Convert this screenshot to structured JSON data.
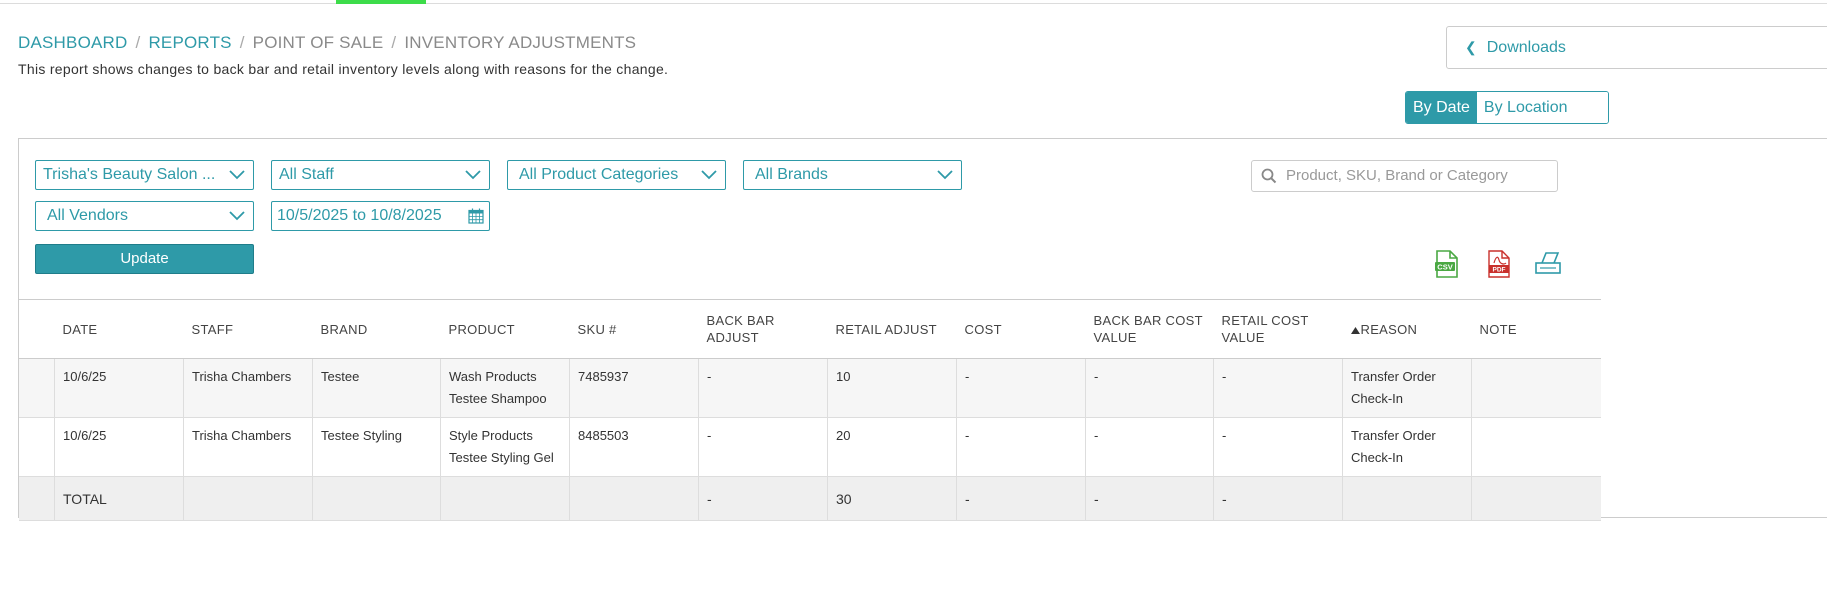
{
  "breadcrumb": {
    "items": [
      "DASHBOARD",
      "REPORTS"
    ],
    "muted": [
      "POINT OF SALE",
      "INVENTORY ADJUSTMENTS"
    ],
    "separator": "/"
  },
  "description": "This report shows changes to back bar and retail inventory levels along with reasons for the change.",
  "downloads_label": "Downloads",
  "view_toggle": {
    "by_date": "By Date",
    "by_location": "By Location"
  },
  "filters": {
    "location": "Trisha's Beauty Salon ...",
    "staff": "All Staff",
    "categories": "All Product Categories",
    "brands": "All Brands",
    "vendors": "All Vendors",
    "date_range": "10/5/2025 to 10/8/2025"
  },
  "search": {
    "placeholder": "Product, SKU, Brand or Category"
  },
  "update_label": "Update",
  "export": {
    "csv": "CSV",
    "pdf": "PDF"
  },
  "colors": {
    "accent": "#2e9aa8",
    "tab_indicator": "#3ddc4a",
    "csv_green": "#4aa843",
    "pdf_red": "#c9302c"
  },
  "table": {
    "headers": [
      "DATE",
      "STAFF",
      "BRAND",
      "PRODUCT",
      "SKU #",
      "BACK BAR ADJUST",
      "RETAIL ADJUST",
      "COST",
      "BACK BAR COST VALUE",
      "RETAIL COST VALUE",
      "REASON",
      "NOTE"
    ],
    "rows": [
      {
        "date": "10/6/25",
        "staff": "Trisha Chambers",
        "brand": "Testee",
        "product_category": "Wash Products",
        "product_name": "Testee Shampoo",
        "sku": "7485937",
        "back_bar_adjust": "-",
        "retail_adjust": "10",
        "cost": "-",
        "back_bar_cost_value": "-",
        "retail_cost_value": "-",
        "reason_line1": "Transfer Order",
        "reason_line2": "Check-In",
        "note": ""
      },
      {
        "date": "10/6/25",
        "staff": "Trisha Chambers",
        "brand": "Testee Styling",
        "product_category": "Style Products",
        "product_name": "Testee Styling Gel",
        "sku": "8485503",
        "back_bar_adjust": "-",
        "retail_adjust": "20",
        "cost": "-",
        "back_bar_cost_value": "-",
        "retail_cost_value": "-",
        "reason_line1": "Transfer Order",
        "reason_line2": "Check-In",
        "note": ""
      }
    ],
    "total": {
      "label": "TOTAL",
      "back_bar_adjust": "-",
      "retail_adjust": "30",
      "cost": "-",
      "back_bar_cost_value": "-",
      "retail_cost_value": "-"
    }
  }
}
